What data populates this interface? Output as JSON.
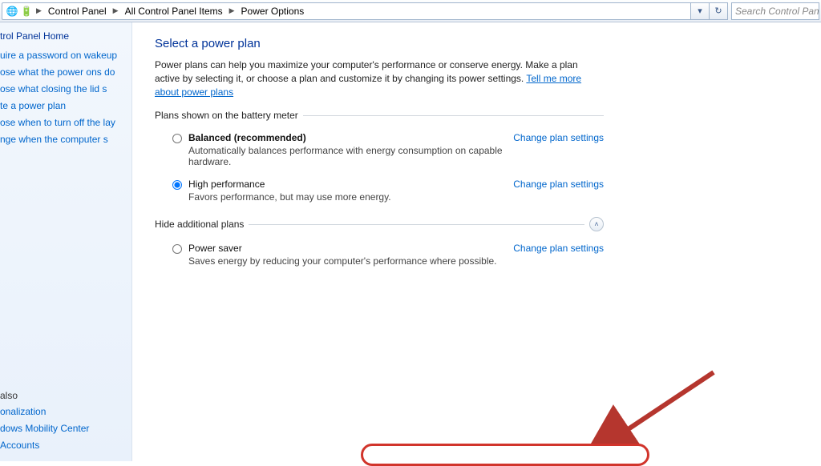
{
  "breadcrumb": {
    "items": [
      "Control Panel",
      "All Control Panel Items",
      "Power Options"
    ]
  },
  "search": {
    "placeholder": "Search Control Pan"
  },
  "sidebar": {
    "heading": "trol Panel Home",
    "links": [
      "uire a password on wakeup",
      "ose what the power ons do",
      "ose what closing the lid s",
      "te a power plan",
      "ose when to turn off the lay",
      "nge when the computer s"
    ],
    "see_also_label": "also",
    "see_also": [
      "onalization",
      "dows Mobility Center",
      "Accounts"
    ]
  },
  "main": {
    "title": "Select a power plan",
    "intro_a": "Power plans can help you maximize your computer's performance or conserve energy. Make a plan active by selecting it, or choose a plan and customize it by changing its power settings. ",
    "intro_link": "Tell me more about power plans",
    "group1_label": "Plans shown on the battery meter",
    "group2_label": "Hide additional plans",
    "change_link": "Change plan settings",
    "plans": [
      {
        "name": "Balanced (recommended)",
        "desc": "Automatically balances performance with energy consumption on capable hardware.",
        "bold": true,
        "selected": false
      },
      {
        "name": "High performance",
        "desc": "Favors performance, but may use more energy.",
        "bold": false,
        "selected": true
      }
    ],
    "hidden_plans": [
      {
        "name": "Power saver",
        "desc": "Saves energy by reducing your computer's performance where possible.",
        "bold": false,
        "selected": false
      }
    ]
  }
}
